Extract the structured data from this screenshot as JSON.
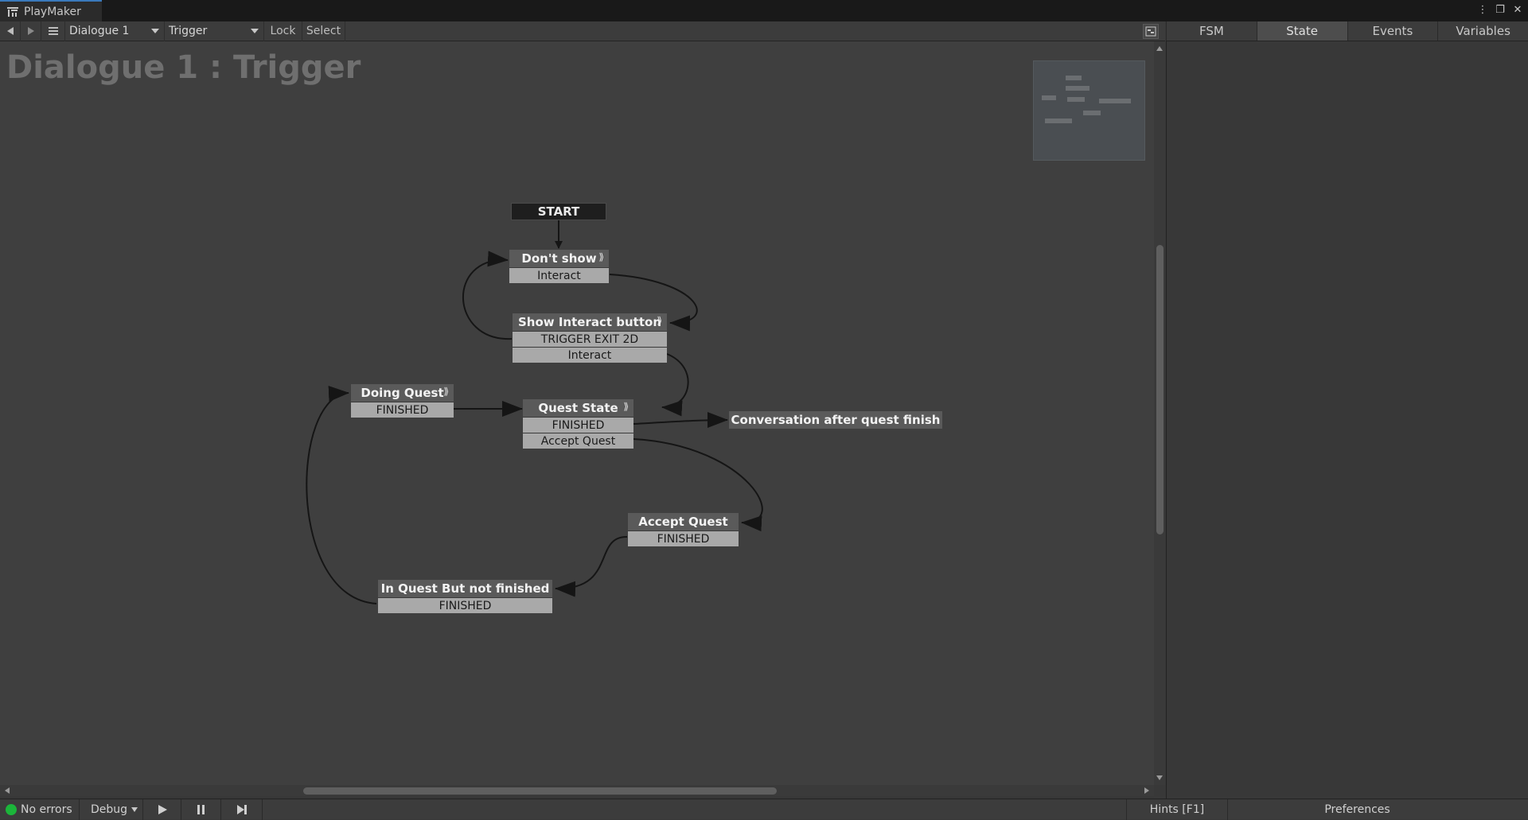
{
  "window": {
    "tab_title": "PlayMaker"
  },
  "toolbar": {
    "back_icon": "arrow-left-icon",
    "forward_icon": "arrow-right-icon",
    "menu_icon": "hamburger-icon",
    "fsm_owner": "Dialogue 1",
    "fsm_name": "Trigger",
    "lock_label": "Lock",
    "select_label": "Select"
  },
  "inspector_tabs": [
    "FSM",
    "State",
    "Events",
    "Variables"
  ],
  "canvas": {
    "title": "Dialogue 1 : Trigger",
    "start_label": "START"
  },
  "states": {
    "dont_show": {
      "name": "Don't show",
      "events": [
        "Interact"
      ]
    },
    "show_interact": {
      "name": "Show Interact button",
      "events": [
        "TRIGGER EXIT 2D",
        "Interact"
      ]
    },
    "doing_quest": {
      "name": "Doing Quest",
      "events": [
        "FINISHED"
      ]
    },
    "quest_state": {
      "name": "Quest State",
      "events": [
        "FINISHED",
        "Accept Quest"
      ]
    },
    "conversation": {
      "name": "Conversation after quest finish",
      "events": []
    },
    "accept_quest": {
      "name": "Accept Quest",
      "events": [
        "FINISHED"
      ]
    },
    "in_quest": {
      "name": "In Quest But not finished",
      "events": [
        "FINISHED"
      ]
    }
  },
  "bottom": {
    "status": "No errors",
    "debug_label": "Debug",
    "hints_label": "Hints [F1]",
    "preferences_label": "Preferences"
  },
  "colors": {
    "status_ok": "#1bb53a",
    "tab_accent": "#3a79bb"
  }
}
